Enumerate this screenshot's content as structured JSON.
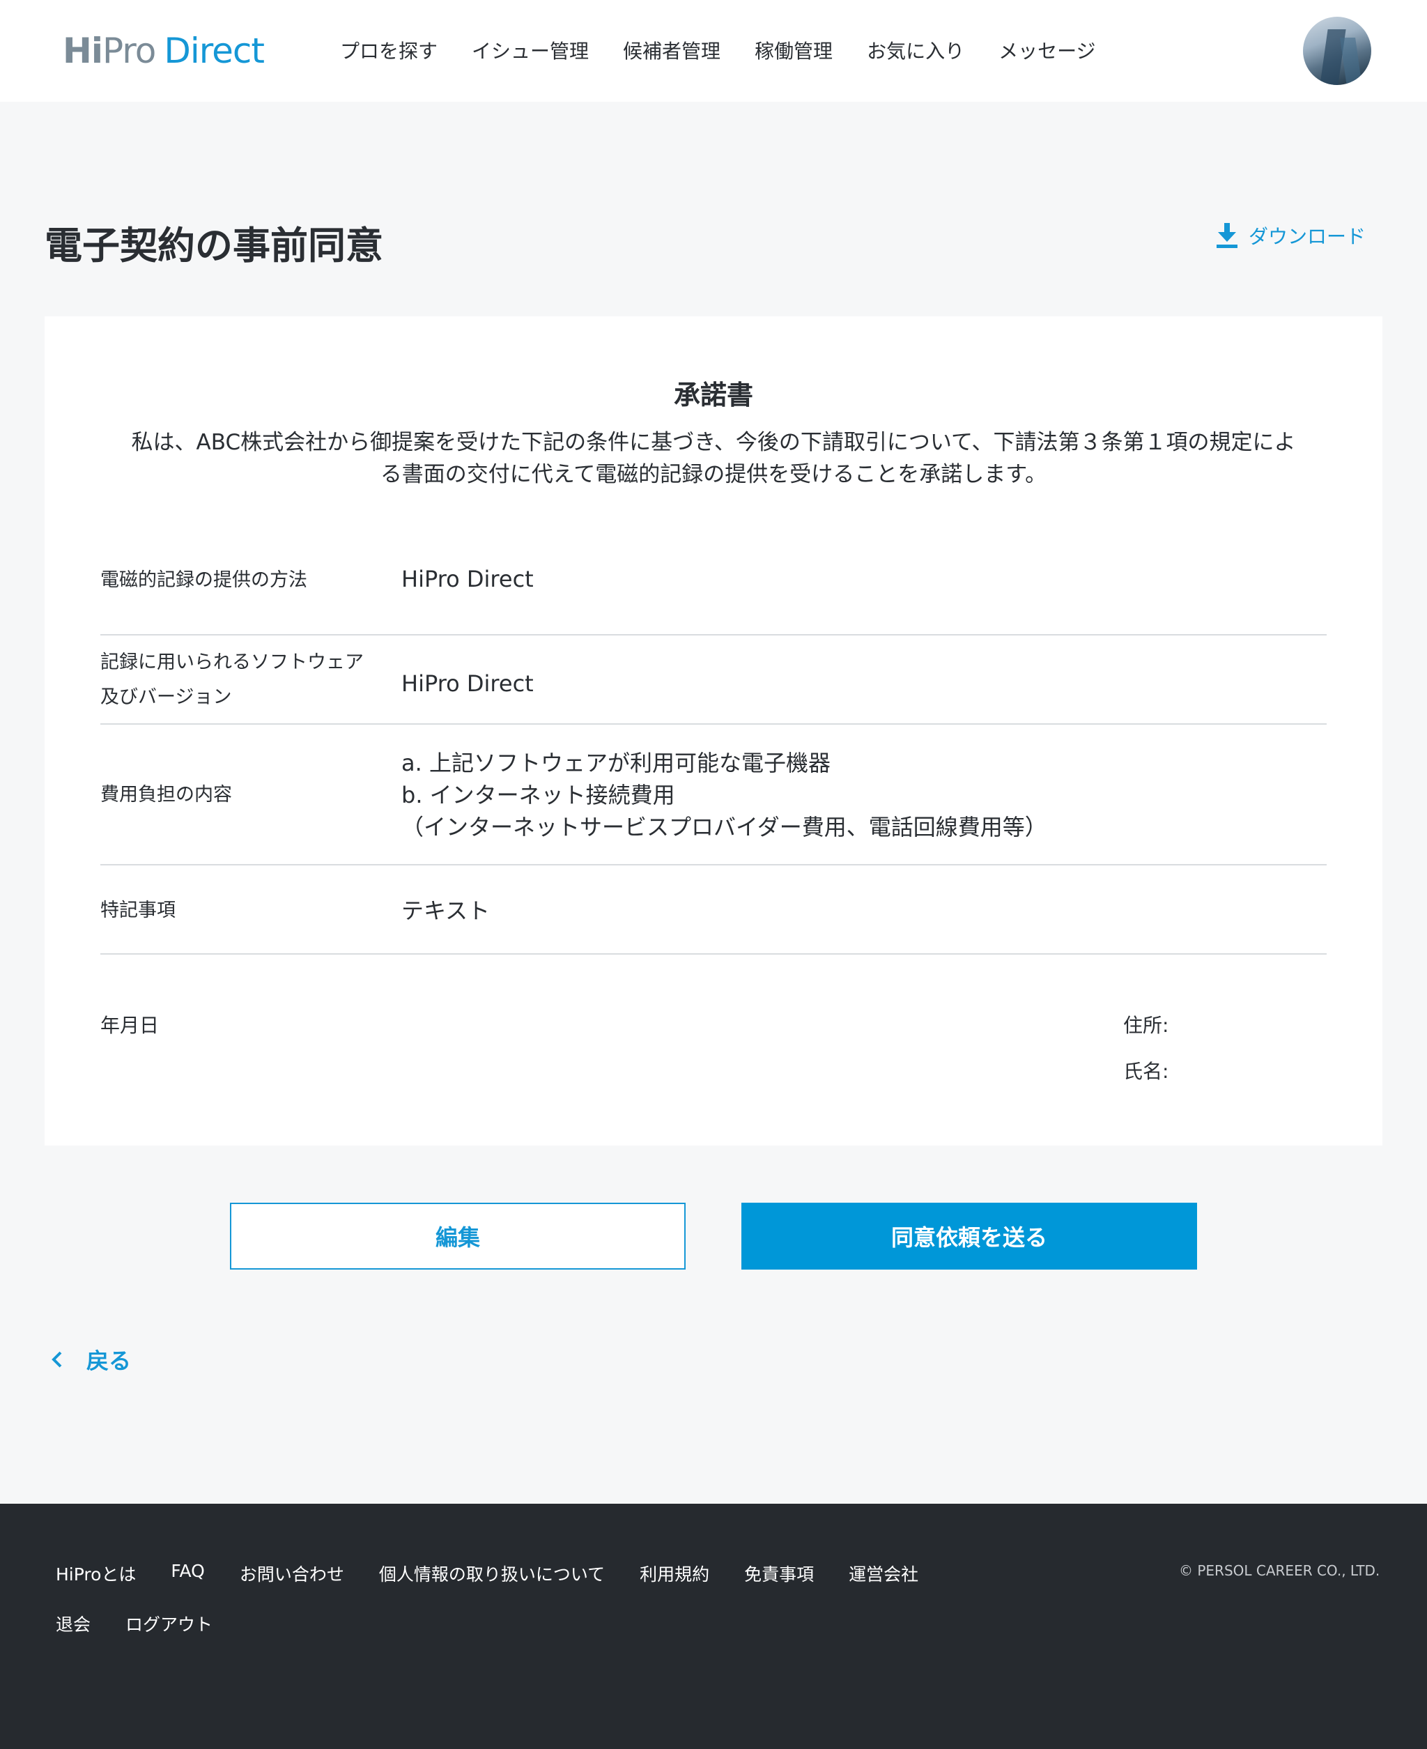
{
  "header": {
    "logo": {
      "hi": "Hi",
      "pro": "Pro",
      "direct": "Direct"
    },
    "nav": [
      "プロを探す",
      "イシュー管理",
      "候補者管理",
      "稼働管理",
      "お気に入り",
      "メッセージ"
    ]
  },
  "page": {
    "title": "電子契約の事前同意",
    "download_label": "ダウンロード"
  },
  "document": {
    "title": "承諾書",
    "body_line1": "私は、ABC株式会社から御提案を受けた下記の条件に基づき、今後の下請取引について、下請法第３条第１項の規定によ",
    "body_line2": "る書面の交付に代えて電磁的記録の提供を受けることを承諾します。",
    "rows": [
      {
        "label_line1": "電磁的記録の提供の方法",
        "value_line1": "HiPro Direct"
      },
      {
        "label_line1": "記録に用いられるソフトウェア",
        "label_line2": "及びバージョン",
        "value_line1": "HiPro Direct"
      },
      {
        "label_line1": "費用負担の内容",
        "value_line1": "a. 上記ソフトウェアが利用可能な電子機器",
        "value_line2": "b. インターネット接続費用",
        "value_line3": "（インターネットサービスプロバイダー費用、電話回線費用等）"
      },
      {
        "label_line1": "特記事項",
        "value_line1": "テキスト"
      }
    ],
    "date_label": "年月日",
    "address_label": "住所:",
    "name_label": "氏名:"
  },
  "actions": {
    "edit_label": "編集",
    "send_label": "同意依頼を送る",
    "back_label": "戻る"
  },
  "footer": {
    "links_row1": [
      "HiProとは",
      "FAQ",
      "お問い合わせ",
      "個人情報の取り扱いについて",
      "利用規約",
      "免責事項",
      "運営会社"
    ],
    "links_row2": [
      "退会",
      "ログアウト"
    ],
    "copyright": "© PERSOL CAREER CO., LTD."
  },
  "colors": {
    "accent": "#0097d8",
    "footer_bg": "#262a2f",
    "page_bg": "#f6f7f8"
  },
  "icons": {
    "download": "download-icon",
    "back": "chevron-left-icon",
    "avatar": "avatar"
  }
}
